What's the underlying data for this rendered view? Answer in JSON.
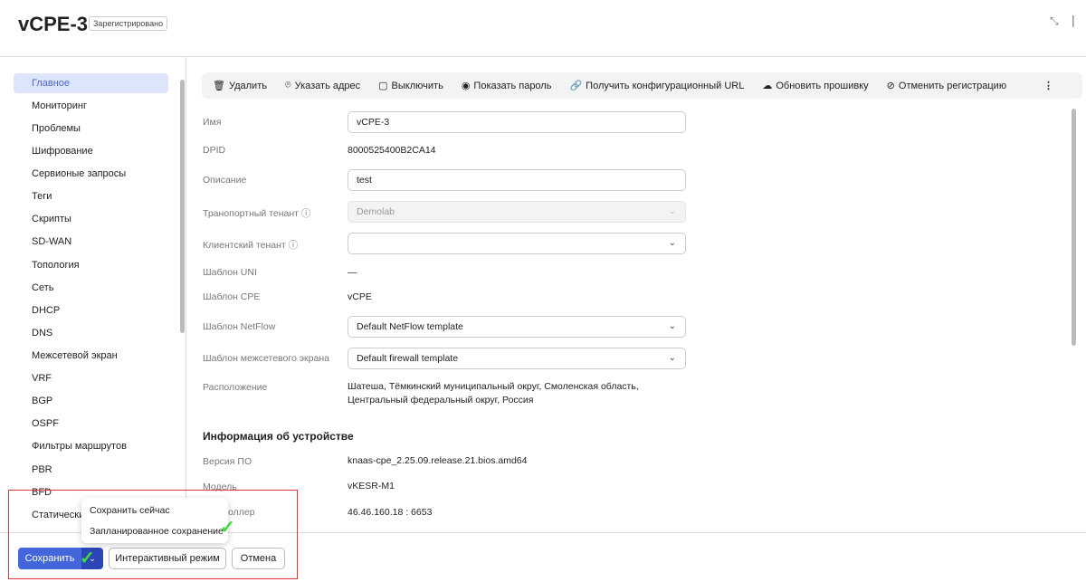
{
  "header": {
    "title": "vCPE-3",
    "status_badge": "Зарегистрировано"
  },
  "sidebar": {
    "items": [
      "Главное",
      "Мониторинг",
      "Проблемы",
      "Шифрование",
      "Сервионые запроcы",
      "Теги",
      "Скрипты",
      "SD-WAN",
      "Топология",
      "Сеть",
      "DHCP",
      "DNS",
      "Межсетевой экран",
      "VRF",
      "BGP",
      "OSPF",
      "Фильтры маршрутов",
      "PBR",
      "BFD",
      "Статически"
    ],
    "active": "Главное"
  },
  "toolbar": {
    "delete": "Удалить",
    "set_address": "Указать адрес",
    "disable": "Выключить",
    "show_password": "Показать пароль",
    "get_config_url": "Получить конфигурационный URL",
    "update_firmware": "Обновить прошивку",
    "unregister": "Отменить регистрацию"
  },
  "form": {
    "name_label": "Имя",
    "name_value": "vCPE-3",
    "dpid_label": "DPID",
    "dpid_value": "8000525400B2CA14",
    "desc_label": "Описание",
    "desc_value": "test",
    "transport_label": "Транопортный тенант",
    "transport_value": "Demolab",
    "client_label": "Клиентский тенант",
    "client_value": "",
    "uni_label": "Шаблон UNI",
    "uni_value": "—",
    "cpe_label": "Шаблон CPE",
    "cpe_value": "vCPE",
    "netflow_label": "Шаблон NetFlow",
    "netflow_value": "Default NetFlow template",
    "firewall_label": "Шаблон межсетевого экрана",
    "firewall_value": "Default firewall template",
    "location_label": "Расположение",
    "location_line1": "Шатеша, Тёмкинский муниципальный округ, Смоленская область,",
    "location_line2": "Центральный федеральный округ, Россия"
  },
  "device": {
    "heading": "Информация об устройстве",
    "fw_label": "Версия ПО",
    "fw_value": "knaas-cpe_2.25.09.release.21.bios.amd64",
    "model_label": "Модель",
    "model_value": "vKESR-M1",
    "controller_label": "оллер",
    "controller_value": "46.46.160.18 : 6653"
  },
  "footer": {
    "save": "Сохранить",
    "interactive": "Интерактивный режим",
    "cancel": "Отмена"
  },
  "save_menu": {
    "now": "Сохранить сейчас",
    "scheduled": "Запланированное сохранение"
  }
}
